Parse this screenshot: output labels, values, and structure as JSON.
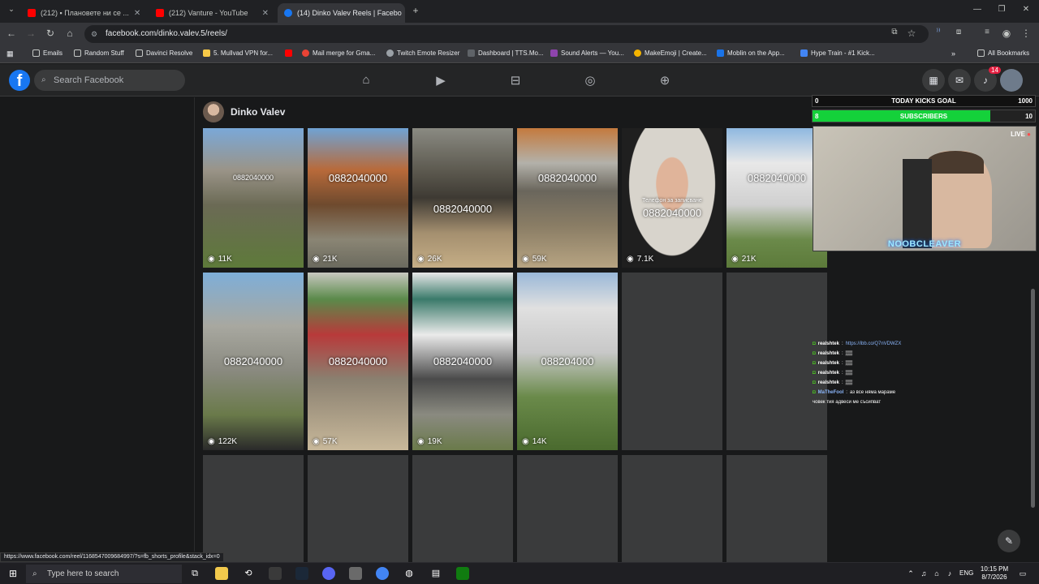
{
  "browser": {
    "tabs": [
      {
        "label": "(212) ▪ Плановете ни се ...",
        "favicon_color": "#ff0000"
      },
      {
        "label": "(212) Vanture - YouTube",
        "favicon_color": "#ff0000"
      },
      {
        "label": "(14) Dinko Valev Reels | Facebo",
        "favicon_color": "#1877f2",
        "active": true
      }
    ],
    "url": "facebook.com/dinko.valev.5/reels/",
    "bookmarks": [
      {
        "label": "Emails",
        "icon": "folder-icon"
      },
      {
        "label": "Random Stuff",
        "icon": "folder-icon"
      },
      {
        "label": "Davinci Resolve",
        "icon": "folder-icon"
      },
      {
        "label": "5. Mullvad VPN for...",
        "icon": "mullvad-icon"
      },
      {
        "label": "",
        "icon": "youtube-icon"
      },
      {
        "label": "Mail merge for Gma...",
        "icon": "mail-merge-icon"
      },
      {
        "label": "Twitch Emote Resizer",
        "icon": "globe-icon"
      },
      {
        "label": "Dashboard | TTS.Mo...",
        "icon": "tts-icon"
      },
      {
        "label": "Sound Alerts — You...",
        "icon": "sound-alerts-icon"
      },
      {
        "label": "MakeEmoji | Create...",
        "icon": "emoji-icon"
      },
      {
        "label": "Moblin on the App...",
        "icon": "app-store-icon"
      },
      {
        "label": "Hype Train - #1 Kick...",
        "icon": "shield-icon"
      }
    ],
    "all_bookmarks": "All Bookmarks"
  },
  "facebook": {
    "search_placeholder": "Search Facebook",
    "notification_count": "14",
    "profile_name": "Dinko Valev"
  },
  "reels": [
    {
      "phone": "0882040000",
      "views": "11K"
    },
    {
      "phone": "0882040000",
      "views": "21K"
    },
    {
      "phone": "0882040000",
      "views": "26K"
    },
    {
      "phone": "0882040000",
      "views": "59K"
    },
    {
      "caption": "Телефон за записване",
      "phone": "0882040000",
      "views": "7.1K"
    },
    {
      "phone": "0882040000",
      "views": "21K"
    },
    {
      "phone": "0882040000",
      "views": "122K"
    },
    {
      "phone": "0882040000",
      "views": "57K"
    },
    {
      "phone": "0882040000",
      "views": "19K"
    },
    {
      "phone": "088204000",
      "views": "14K"
    }
  ],
  "stream": {
    "goal_start": "0",
    "goal_label": "TODAY KICKS GOAL",
    "goal_end": "1000",
    "subs_start": "8",
    "subs_label": "SUBSCRIBERS",
    "subs_end": "10",
    "subs_progress": 0.8,
    "live_label": "LIVE",
    "streamer_name": "NOOBCLEAVER",
    "chat": [
      {
        "user": "realshtek",
        "message": "https://ibb.co/Q7nVDWZX"
      },
      {
        "user": "realshtek",
        "message": "▒▒"
      },
      {
        "user": "realshtek",
        "message": "▒▒"
      },
      {
        "user": "realshtek",
        "message": "▒▒"
      },
      {
        "user": "realshtek",
        "message": "▒▒"
      },
      {
        "user": "MaTheFool",
        "message": "аз все няма мараме"
      },
      {
        "user": "",
        "message": "човек тия адвеси ме съсипват"
      }
    ]
  },
  "status_url": "https://www.facebook.com/reel/1168547009684997/?s=fb_shorts_profile&stack_idx=0",
  "taskbar": {
    "search_placeholder": "Type here to search",
    "language": "ENG",
    "time": "10:15 PM",
    "date": "8/7/2026"
  }
}
